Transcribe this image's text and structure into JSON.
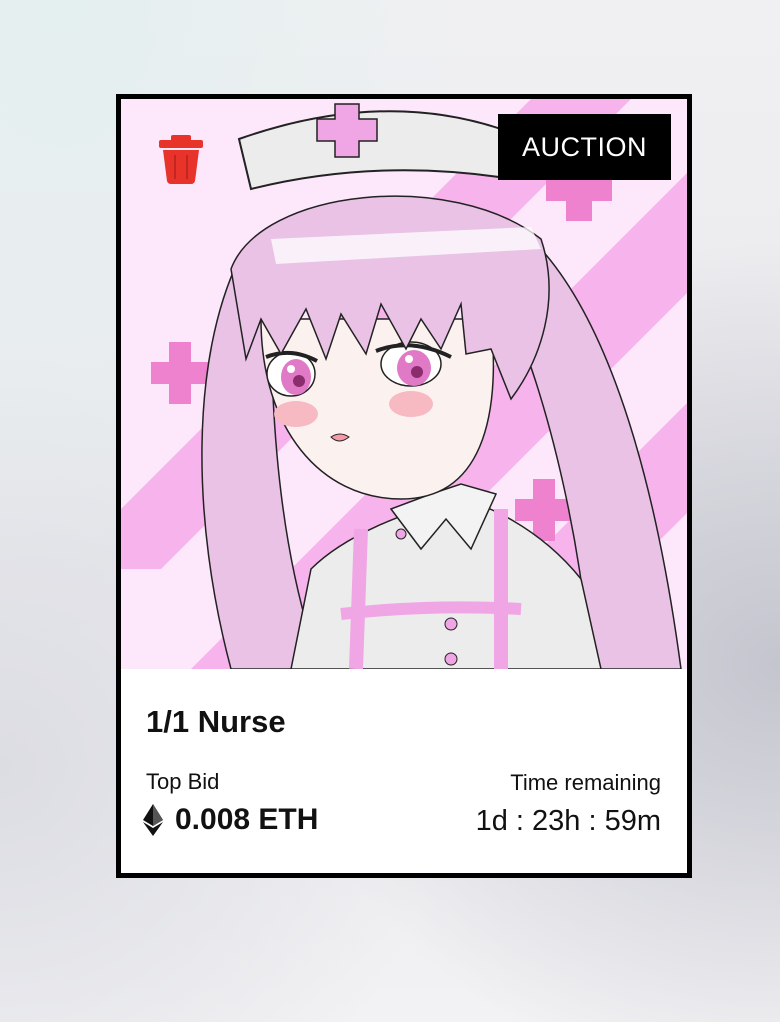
{
  "card": {
    "badge": "AUCTION",
    "title": "1/1 Nurse",
    "bid_label": "Top Bid",
    "bid_value": "0.008 ETH",
    "time_label": "Time remaining",
    "time_value": "1d : 23h : 59m"
  },
  "icons": {
    "delete": "trash-icon",
    "currency": "ethereum-icon"
  },
  "colors": {
    "badge_bg": "#000000",
    "trash": "#e8332a",
    "art_bg": "#fde7fb",
    "art_stripe": "#f7b3ec",
    "art_cross": "#ee82cf",
    "hair": "#e9c2e6"
  }
}
